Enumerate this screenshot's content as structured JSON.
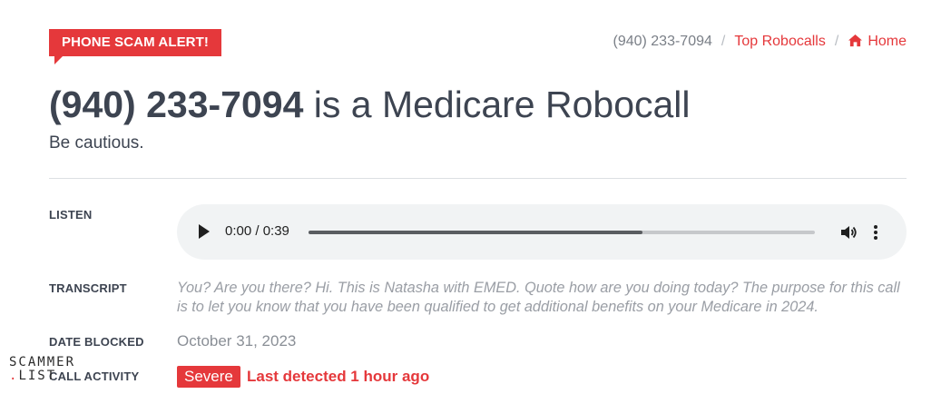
{
  "alert": {
    "label": "PHONE SCAM ALERT!"
  },
  "breadcrumb": {
    "phone": "(940) 233-7094",
    "sep1": "/",
    "top": "Top Robocalls",
    "sep2": "/",
    "home": "Home"
  },
  "heading": {
    "number": "(940) 233-7094",
    "rest": " is a Medicare Robocall",
    "subtitle": "Be cautious."
  },
  "labels": {
    "listen": "LISTEN",
    "transcript": "TRANSCRIPT",
    "date_blocked": "DATE BLOCKED",
    "call_activity": "CALL ACTIVITY"
  },
  "player": {
    "time": "0:00 / 0:39",
    "progress": 0.66
  },
  "transcript": "You? Are you there? Hi. This is Natasha with EMED. Quote how are you doing today? The purpose for this call is to let you know that you have been qualified to get additional benefits on your Medicare in 2024.",
  "date_blocked": "October 31, 2023",
  "activity": {
    "badge": "Severe",
    "last": "Last detected 1 hour ago"
  },
  "watermark": {
    "line1": "SCAMMER",
    "line2": "LIST"
  },
  "colors": {
    "accent": "#e5383b",
    "text": "#3d4451",
    "muted": "#9a9ea5"
  }
}
